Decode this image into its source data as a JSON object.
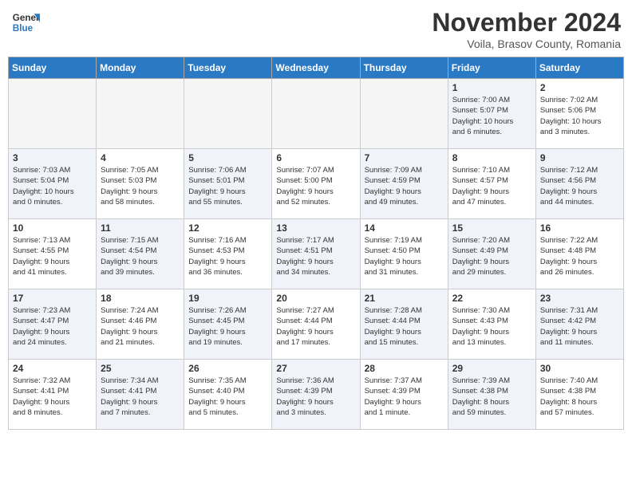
{
  "logo": {
    "line1": "General",
    "line2": "Blue"
  },
  "title": "November 2024",
  "subtitle": "Voila, Brasov County, Romania",
  "days_of_week": [
    "Sunday",
    "Monday",
    "Tuesday",
    "Wednesday",
    "Thursday",
    "Friday",
    "Saturday"
  ],
  "weeks": [
    [
      {
        "day": "",
        "info": "",
        "empty": true
      },
      {
        "day": "",
        "info": "",
        "empty": true
      },
      {
        "day": "",
        "info": "",
        "empty": true
      },
      {
        "day": "",
        "info": "",
        "empty": true
      },
      {
        "day": "",
        "info": "",
        "empty": true
      },
      {
        "day": "1",
        "info": "Sunrise: 7:00 AM\nSunset: 5:07 PM\nDaylight: 10 hours\nand 6 minutes.",
        "shaded": true
      },
      {
        "day": "2",
        "info": "Sunrise: 7:02 AM\nSunset: 5:06 PM\nDaylight: 10 hours\nand 3 minutes.",
        "shaded": false
      }
    ],
    [
      {
        "day": "3",
        "info": "Sunrise: 7:03 AM\nSunset: 5:04 PM\nDaylight: 10 hours\nand 0 minutes.",
        "shaded": true
      },
      {
        "day": "4",
        "info": "Sunrise: 7:05 AM\nSunset: 5:03 PM\nDaylight: 9 hours\nand 58 minutes.",
        "shaded": false
      },
      {
        "day": "5",
        "info": "Sunrise: 7:06 AM\nSunset: 5:01 PM\nDaylight: 9 hours\nand 55 minutes.",
        "shaded": true
      },
      {
        "day": "6",
        "info": "Sunrise: 7:07 AM\nSunset: 5:00 PM\nDaylight: 9 hours\nand 52 minutes.",
        "shaded": false
      },
      {
        "day": "7",
        "info": "Sunrise: 7:09 AM\nSunset: 4:59 PM\nDaylight: 9 hours\nand 49 minutes.",
        "shaded": true
      },
      {
        "day": "8",
        "info": "Sunrise: 7:10 AM\nSunset: 4:57 PM\nDaylight: 9 hours\nand 47 minutes.",
        "shaded": false
      },
      {
        "day": "9",
        "info": "Sunrise: 7:12 AM\nSunset: 4:56 PM\nDaylight: 9 hours\nand 44 minutes.",
        "shaded": true
      }
    ],
    [
      {
        "day": "10",
        "info": "Sunrise: 7:13 AM\nSunset: 4:55 PM\nDaylight: 9 hours\nand 41 minutes.",
        "shaded": false
      },
      {
        "day": "11",
        "info": "Sunrise: 7:15 AM\nSunset: 4:54 PM\nDaylight: 9 hours\nand 39 minutes.",
        "shaded": true
      },
      {
        "day": "12",
        "info": "Sunrise: 7:16 AM\nSunset: 4:53 PM\nDaylight: 9 hours\nand 36 minutes.",
        "shaded": false
      },
      {
        "day": "13",
        "info": "Sunrise: 7:17 AM\nSunset: 4:51 PM\nDaylight: 9 hours\nand 34 minutes.",
        "shaded": true
      },
      {
        "day": "14",
        "info": "Sunrise: 7:19 AM\nSunset: 4:50 PM\nDaylight: 9 hours\nand 31 minutes.",
        "shaded": false
      },
      {
        "day": "15",
        "info": "Sunrise: 7:20 AM\nSunset: 4:49 PM\nDaylight: 9 hours\nand 29 minutes.",
        "shaded": true
      },
      {
        "day": "16",
        "info": "Sunrise: 7:22 AM\nSunset: 4:48 PM\nDaylight: 9 hours\nand 26 minutes.",
        "shaded": false
      }
    ],
    [
      {
        "day": "17",
        "info": "Sunrise: 7:23 AM\nSunset: 4:47 PM\nDaylight: 9 hours\nand 24 minutes.",
        "shaded": true
      },
      {
        "day": "18",
        "info": "Sunrise: 7:24 AM\nSunset: 4:46 PM\nDaylight: 9 hours\nand 21 minutes.",
        "shaded": false
      },
      {
        "day": "19",
        "info": "Sunrise: 7:26 AM\nSunset: 4:45 PM\nDaylight: 9 hours\nand 19 minutes.",
        "shaded": true
      },
      {
        "day": "20",
        "info": "Sunrise: 7:27 AM\nSunset: 4:44 PM\nDaylight: 9 hours\nand 17 minutes.",
        "shaded": false
      },
      {
        "day": "21",
        "info": "Sunrise: 7:28 AM\nSunset: 4:44 PM\nDaylight: 9 hours\nand 15 minutes.",
        "shaded": true
      },
      {
        "day": "22",
        "info": "Sunrise: 7:30 AM\nSunset: 4:43 PM\nDaylight: 9 hours\nand 13 minutes.",
        "shaded": false
      },
      {
        "day": "23",
        "info": "Sunrise: 7:31 AM\nSunset: 4:42 PM\nDaylight: 9 hours\nand 11 minutes.",
        "shaded": true
      }
    ],
    [
      {
        "day": "24",
        "info": "Sunrise: 7:32 AM\nSunset: 4:41 PM\nDaylight: 9 hours\nand 8 minutes.",
        "shaded": false
      },
      {
        "day": "25",
        "info": "Sunrise: 7:34 AM\nSunset: 4:41 PM\nDaylight: 9 hours\nand 7 minutes.",
        "shaded": true
      },
      {
        "day": "26",
        "info": "Sunrise: 7:35 AM\nSunset: 4:40 PM\nDaylight: 9 hours\nand 5 minutes.",
        "shaded": false
      },
      {
        "day": "27",
        "info": "Sunrise: 7:36 AM\nSunset: 4:39 PM\nDaylight: 9 hours\nand 3 minutes.",
        "shaded": true
      },
      {
        "day": "28",
        "info": "Sunrise: 7:37 AM\nSunset: 4:39 PM\nDaylight: 9 hours\nand 1 minute.",
        "shaded": false
      },
      {
        "day": "29",
        "info": "Sunrise: 7:39 AM\nSunset: 4:38 PM\nDaylight: 8 hours\nand 59 minutes.",
        "shaded": true
      },
      {
        "day": "30",
        "info": "Sunrise: 7:40 AM\nSunset: 4:38 PM\nDaylight: 8 hours\nand 57 minutes.",
        "shaded": false
      }
    ]
  ]
}
